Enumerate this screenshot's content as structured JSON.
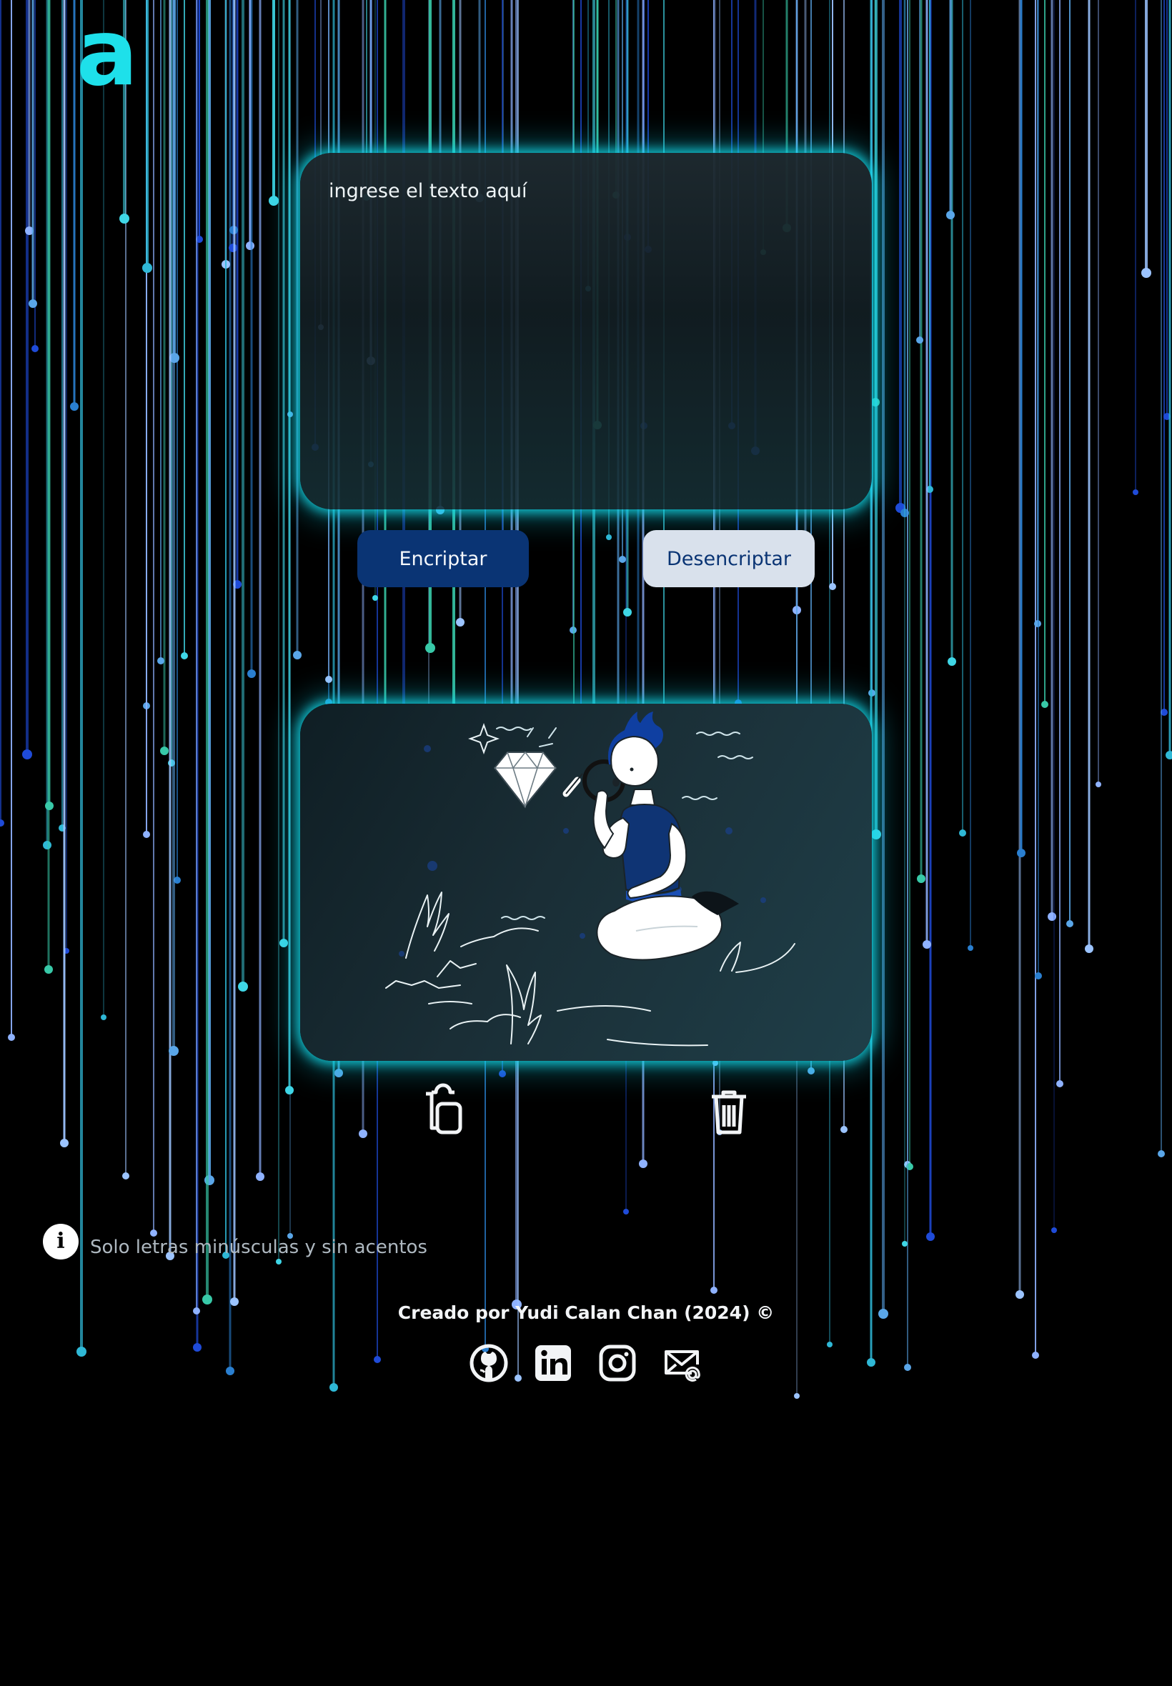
{
  "app": {
    "logo_glyph": "a",
    "accent_color": "#1ee0ea"
  },
  "input": {
    "placeholder": "ingrese el texto aquí",
    "value": ""
  },
  "actions": {
    "encrypt_label": "Encriptar",
    "decrypt_label": "Desencriptar",
    "encrypt_bg": "#0a3474",
    "decrypt_bg": "#d9e1ec"
  },
  "output": {
    "illustration": "person-with-magnifying-glass-and-diamond",
    "copy_icon": "clipboard-copy-icon",
    "clear_icon": "trash-icon"
  },
  "info": {
    "icon": "info-icon",
    "text": "Solo letras minúsculas y sin acentos"
  },
  "footer": {
    "credit": "Creado por Yudi Calan Chan (2024) ©",
    "social": [
      {
        "icon": "github-icon"
      },
      {
        "icon": "linkedin-icon"
      },
      {
        "icon": "instagram-icon"
      },
      {
        "icon": "mail-icon"
      }
    ]
  }
}
